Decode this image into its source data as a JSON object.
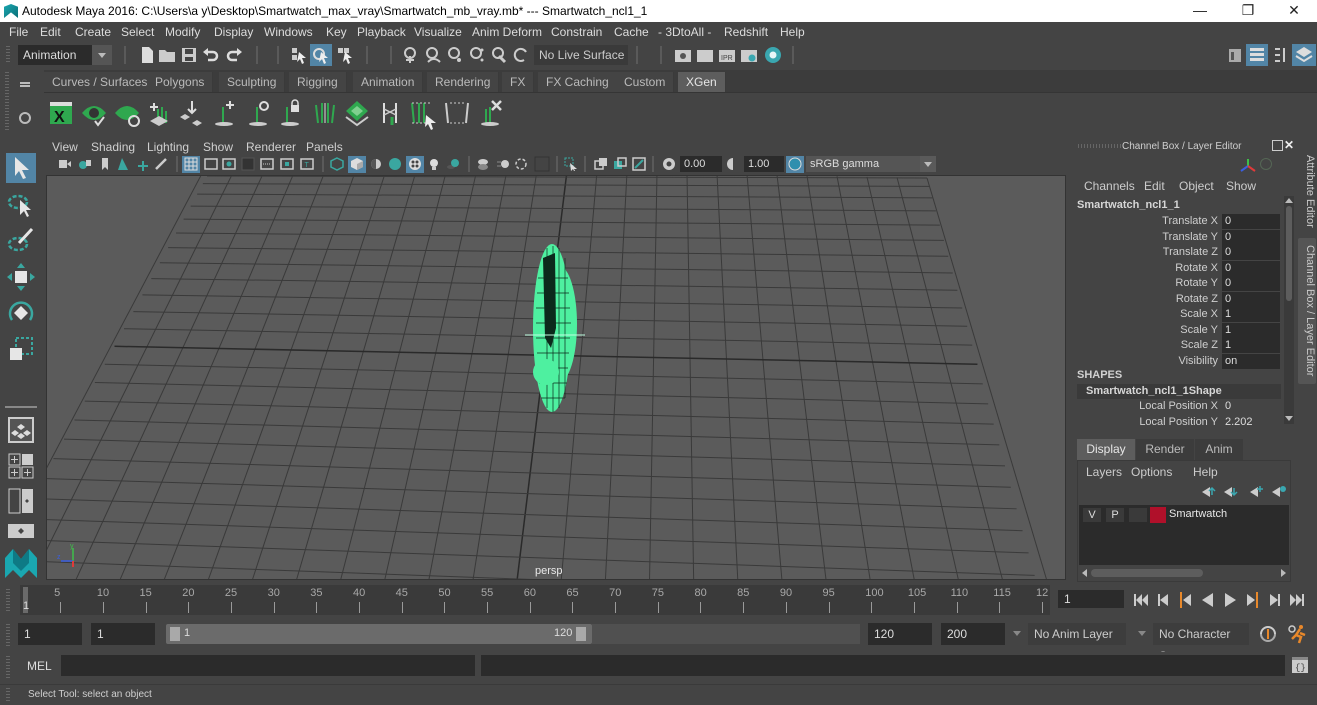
{
  "window": {
    "title": "Autodesk Maya 2016: C:\\Users\\a y\\Desktop\\Smartwatch_max_vray\\Smartwatch_mb_vray.mb*   ---   Smartwatch_ncl1_1",
    "minimize": "—",
    "restore": "❐",
    "close": "✕"
  },
  "menubar": [
    "File",
    "Edit",
    "Create",
    "Select",
    "Modify",
    "Display",
    "Windows",
    "Key",
    "Playback",
    "Visualize",
    "Anim Deform",
    "Constrain",
    "Cache",
    "- 3DtoAll -",
    "Redshift",
    "Help"
  ],
  "status_line": {
    "mode_menu": "Animation",
    "live_surface": "No Live Surface"
  },
  "shelf": {
    "tabs": [
      "Curves / Surfaces",
      "Polygons",
      "Sculpting",
      "Rigging",
      "Animation",
      "Rendering",
      "FX",
      "FX Caching",
      "Custom",
      "XGen"
    ],
    "active_tab": "XGen",
    "icons": [
      "xgen-editor-icon",
      "xgen-preview-icon",
      "xgen-clear-preview-icon",
      "add-guides-icon",
      "sculpt-guides-icon",
      "add-guide-icon",
      "select-guide-icon",
      "lock-guide-icon",
      "guide-length-icon",
      "region-map-icon",
      "rebuild-guides-icon",
      "guide-select-icon",
      "normalize-guides-icon",
      "delete-guides-icon"
    ]
  },
  "viewport": {
    "menu": [
      "View",
      "Shading",
      "Lighting",
      "Show",
      "Renderer",
      "Panels"
    ],
    "exposure": "0.00",
    "gamma": "1.00",
    "color_space": "sRGB gamma",
    "camera_label": "persp",
    "axis": {
      "y": "y",
      "z": "z",
      "x": "x"
    },
    "selected_wire_color": "#4ef0a0"
  },
  "channel_box": {
    "header": "Channel Box / Layer Editor",
    "menu": [
      "Channels",
      "Edit",
      "Object",
      "Show"
    ],
    "object_name": "Smartwatch_ncl1_1",
    "attributes": [
      {
        "label": "Translate X",
        "value": "0"
      },
      {
        "label": "Translate Y",
        "value": "0"
      },
      {
        "label": "Translate Z",
        "value": "0"
      },
      {
        "label": "Rotate X",
        "value": "0"
      },
      {
        "label": "Rotate Y",
        "value": "0"
      },
      {
        "label": "Rotate Z",
        "value": "0"
      },
      {
        "label": "Scale X",
        "value": "1"
      },
      {
        "label": "Scale Y",
        "value": "1"
      },
      {
        "label": "Scale Z",
        "value": "1"
      },
      {
        "label": "Visibility",
        "value": "on"
      }
    ],
    "shapes_header": "SHAPES",
    "shape_name": "Smartwatch_ncl1_1Shape",
    "shape_attributes": [
      {
        "label": "Local Position X",
        "value": "0"
      },
      {
        "label": "Local Position Y",
        "value": "2.202"
      }
    ]
  },
  "side_tabs": [
    "Attribute Editor",
    "Channel Box / Layer Editor"
  ],
  "layer_editor": {
    "tabs": [
      "Display",
      "Render",
      "Anim"
    ],
    "active_tab": "Display",
    "menu": [
      "Layers",
      "Options",
      "Help"
    ],
    "layers": [
      {
        "v": "V",
        "p": "P",
        "name": "Smartwatch",
        "color": "#b0102a"
      }
    ]
  },
  "timeline": {
    "ticks": [
      "5",
      "10",
      "15",
      "20",
      "25",
      "30",
      "35",
      "40",
      "45",
      "50",
      "55",
      "60",
      "65",
      "70",
      "75",
      "80",
      "85",
      "90",
      "95",
      "100",
      "105",
      "110",
      "115",
      "12"
    ],
    "current_frame_marker": "1",
    "current_frame": "1"
  },
  "range": {
    "start_time": "1",
    "playback_start": "1",
    "slider_start": "1",
    "slider_end": "120",
    "playback_end": "120",
    "end_time": "200",
    "anim_layer": "No Anim Layer",
    "character_set": "No Character Set"
  },
  "command_line": {
    "label": "MEL"
  },
  "help_line": "Select Tool: select an object"
}
